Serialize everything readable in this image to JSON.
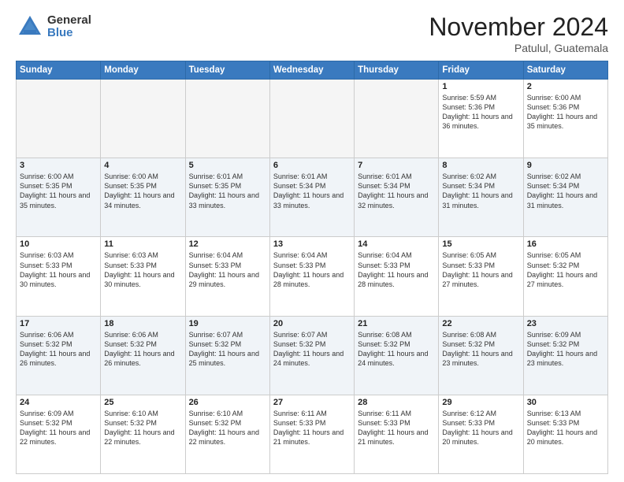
{
  "logo": {
    "general": "General",
    "blue": "Blue"
  },
  "title": "November 2024",
  "location": "Patulul, Guatemala",
  "weekdays": [
    "Sunday",
    "Monday",
    "Tuesday",
    "Wednesday",
    "Thursday",
    "Friday",
    "Saturday"
  ],
  "weeks": [
    [
      {
        "day": "",
        "empty": true
      },
      {
        "day": "",
        "empty": true
      },
      {
        "day": "",
        "empty": true
      },
      {
        "day": "",
        "empty": true
      },
      {
        "day": "",
        "empty": true
      },
      {
        "day": "1",
        "sunrise": "Sunrise: 5:59 AM",
        "sunset": "Sunset: 5:36 PM",
        "daylight": "Daylight: 11 hours and 36 minutes."
      },
      {
        "day": "2",
        "sunrise": "Sunrise: 6:00 AM",
        "sunset": "Sunset: 5:36 PM",
        "daylight": "Daylight: 11 hours and 35 minutes."
      }
    ],
    [
      {
        "day": "3",
        "sunrise": "Sunrise: 6:00 AM",
        "sunset": "Sunset: 5:35 PM",
        "daylight": "Daylight: 11 hours and 35 minutes."
      },
      {
        "day": "4",
        "sunrise": "Sunrise: 6:00 AM",
        "sunset": "Sunset: 5:35 PM",
        "daylight": "Daylight: 11 hours and 34 minutes."
      },
      {
        "day": "5",
        "sunrise": "Sunrise: 6:01 AM",
        "sunset": "Sunset: 5:35 PM",
        "daylight": "Daylight: 11 hours and 33 minutes."
      },
      {
        "day": "6",
        "sunrise": "Sunrise: 6:01 AM",
        "sunset": "Sunset: 5:34 PM",
        "daylight": "Daylight: 11 hours and 33 minutes."
      },
      {
        "day": "7",
        "sunrise": "Sunrise: 6:01 AM",
        "sunset": "Sunset: 5:34 PM",
        "daylight": "Daylight: 11 hours and 32 minutes."
      },
      {
        "day": "8",
        "sunrise": "Sunrise: 6:02 AM",
        "sunset": "Sunset: 5:34 PM",
        "daylight": "Daylight: 11 hours and 31 minutes."
      },
      {
        "day": "9",
        "sunrise": "Sunrise: 6:02 AM",
        "sunset": "Sunset: 5:34 PM",
        "daylight": "Daylight: 11 hours and 31 minutes."
      }
    ],
    [
      {
        "day": "10",
        "sunrise": "Sunrise: 6:03 AM",
        "sunset": "Sunset: 5:33 PM",
        "daylight": "Daylight: 11 hours and 30 minutes."
      },
      {
        "day": "11",
        "sunrise": "Sunrise: 6:03 AM",
        "sunset": "Sunset: 5:33 PM",
        "daylight": "Daylight: 11 hours and 30 minutes."
      },
      {
        "day": "12",
        "sunrise": "Sunrise: 6:04 AM",
        "sunset": "Sunset: 5:33 PM",
        "daylight": "Daylight: 11 hours and 29 minutes."
      },
      {
        "day": "13",
        "sunrise": "Sunrise: 6:04 AM",
        "sunset": "Sunset: 5:33 PM",
        "daylight": "Daylight: 11 hours and 28 minutes."
      },
      {
        "day": "14",
        "sunrise": "Sunrise: 6:04 AM",
        "sunset": "Sunset: 5:33 PM",
        "daylight": "Daylight: 11 hours and 28 minutes."
      },
      {
        "day": "15",
        "sunrise": "Sunrise: 6:05 AM",
        "sunset": "Sunset: 5:33 PM",
        "daylight": "Daylight: 11 hours and 27 minutes."
      },
      {
        "day": "16",
        "sunrise": "Sunrise: 6:05 AM",
        "sunset": "Sunset: 5:32 PM",
        "daylight": "Daylight: 11 hours and 27 minutes."
      }
    ],
    [
      {
        "day": "17",
        "sunrise": "Sunrise: 6:06 AM",
        "sunset": "Sunset: 5:32 PM",
        "daylight": "Daylight: 11 hours and 26 minutes."
      },
      {
        "day": "18",
        "sunrise": "Sunrise: 6:06 AM",
        "sunset": "Sunset: 5:32 PM",
        "daylight": "Daylight: 11 hours and 26 minutes."
      },
      {
        "day": "19",
        "sunrise": "Sunrise: 6:07 AM",
        "sunset": "Sunset: 5:32 PM",
        "daylight": "Daylight: 11 hours and 25 minutes."
      },
      {
        "day": "20",
        "sunrise": "Sunrise: 6:07 AM",
        "sunset": "Sunset: 5:32 PM",
        "daylight": "Daylight: 11 hours and 24 minutes."
      },
      {
        "day": "21",
        "sunrise": "Sunrise: 6:08 AM",
        "sunset": "Sunset: 5:32 PM",
        "daylight": "Daylight: 11 hours and 24 minutes."
      },
      {
        "day": "22",
        "sunrise": "Sunrise: 6:08 AM",
        "sunset": "Sunset: 5:32 PM",
        "daylight": "Daylight: 11 hours and 23 minutes."
      },
      {
        "day": "23",
        "sunrise": "Sunrise: 6:09 AM",
        "sunset": "Sunset: 5:32 PM",
        "daylight": "Daylight: 11 hours and 23 minutes."
      }
    ],
    [
      {
        "day": "24",
        "sunrise": "Sunrise: 6:09 AM",
        "sunset": "Sunset: 5:32 PM",
        "daylight": "Daylight: 11 hours and 22 minutes."
      },
      {
        "day": "25",
        "sunrise": "Sunrise: 6:10 AM",
        "sunset": "Sunset: 5:32 PM",
        "daylight": "Daylight: 11 hours and 22 minutes."
      },
      {
        "day": "26",
        "sunrise": "Sunrise: 6:10 AM",
        "sunset": "Sunset: 5:32 PM",
        "daylight": "Daylight: 11 hours and 22 minutes."
      },
      {
        "day": "27",
        "sunrise": "Sunrise: 6:11 AM",
        "sunset": "Sunset: 5:33 PM",
        "daylight": "Daylight: 11 hours and 21 minutes."
      },
      {
        "day": "28",
        "sunrise": "Sunrise: 6:11 AM",
        "sunset": "Sunset: 5:33 PM",
        "daylight": "Daylight: 11 hours and 21 minutes."
      },
      {
        "day": "29",
        "sunrise": "Sunrise: 6:12 AM",
        "sunset": "Sunset: 5:33 PM",
        "daylight": "Daylight: 11 hours and 20 minutes."
      },
      {
        "day": "30",
        "sunrise": "Sunrise: 6:13 AM",
        "sunset": "Sunset: 5:33 PM",
        "daylight": "Daylight: 11 hours and 20 minutes."
      }
    ]
  ]
}
